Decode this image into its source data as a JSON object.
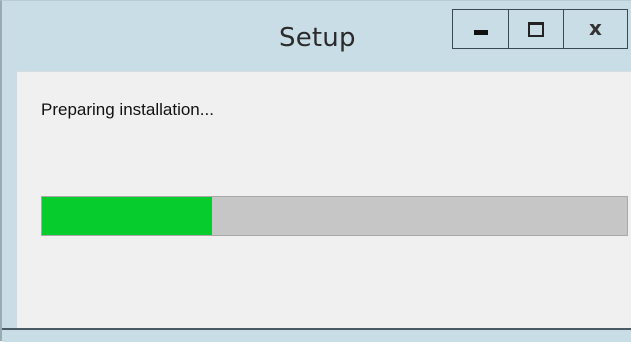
{
  "window": {
    "title": "Setup",
    "controls": {
      "minimize_icon": "minimize-icon",
      "maximize_icon": "maximize-icon",
      "close_icon": "close-icon",
      "close_label": "x"
    }
  },
  "main": {
    "status_text": "Preparing installation...",
    "progress": {
      "fraction": 0.29,
      "fill_color": "#06cc2e",
      "track_color": "#c6c6c6"
    }
  },
  "colors": {
    "titlebar": "#c9dde6",
    "content_bg": "#f0f0f0"
  }
}
